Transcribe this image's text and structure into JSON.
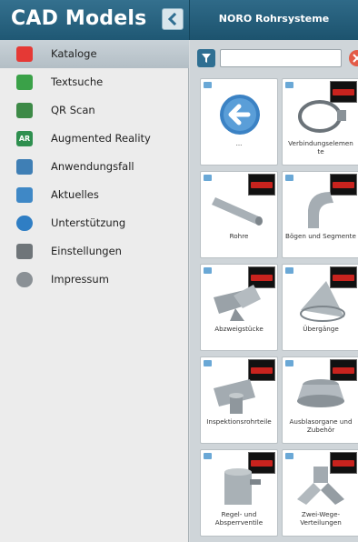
{
  "header": {
    "title": "CAD Models",
    "company": "NORO Rohrsysteme"
  },
  "sidebar": {
    "items": [
      {
        "label": "Kataloge",
        "icon": "catalog-icon",
        "active": true,
        "color": "#e53935"
      },
      {
        "label": "Textsuche",
        "icon": "text-search-icon",
        "color": "#3aa148"
      },
      {
        "label": "QR Scan",
        "icon": "qr-scan-icon",
        "color": "#3d8a47"
      },
      {
        "label": "Augmented Reality",
        "icon": "augmented-reality-icon",
        "badge": "AR",
        "color": "#2e8f4f"
      },
      {
        "label": "Anwendungsfall",
        "icon": "use-case-icon",
        "color": "#3f7fb5"
      },
      {
        "label": "Aktuelles",
        "icon": "news-icon",
        "color": "#3f88c6"
      },
      {
        "label": "Unterstützung",
        "icon": "support-icon",
        "color": "#2f7ec4"
      },
      {
        "label": "Einstellungen",
        "icon": "settings-icon",
        "color": "#6f7579"
      },
      {
        "label": "Impressum",
        "icon": "info-icon",
        "color": "#8a9095"
      }
    ]
  },
  "toolbar": {
    "search_value": "",
    "search_placeholder": ""
  },
  "tiles": [
    {
      "label": "...",
      "kind": "back"
    },
    {
      "label": "Verbindungselemen te",
      "kind": "clamp"
    },
    {
      "label": "Rohre",
      "kind": "pipe"
    },
    {
      "label": "Bögen und Segmente",
      "kind": "bend"
    },
    {
      "label": "Abzweigstücke",
      "kind": "branch"
    },
    {
      "label": "Übergänge",
      "kind": "cone"
    },
    {
      "label": "Inspektionsrohrteile",
      "kind": "inspection"
    },
    {
      "label": "Ausblasorgane und Zubehör",
      "kind": "outlet"
    },
    {
      "label": "Regel- und Absperrventile",
      "kind": "valve"
    },
    {
      "label": "Zwei-Wege-Verteilungen",
      "kind": "splitter"
    }
  ],
  "colors": {
    "header": "#2a6685",
    "active_row": "#bcc6cc",
    "accent_red": "#c8231e"
  }
}
